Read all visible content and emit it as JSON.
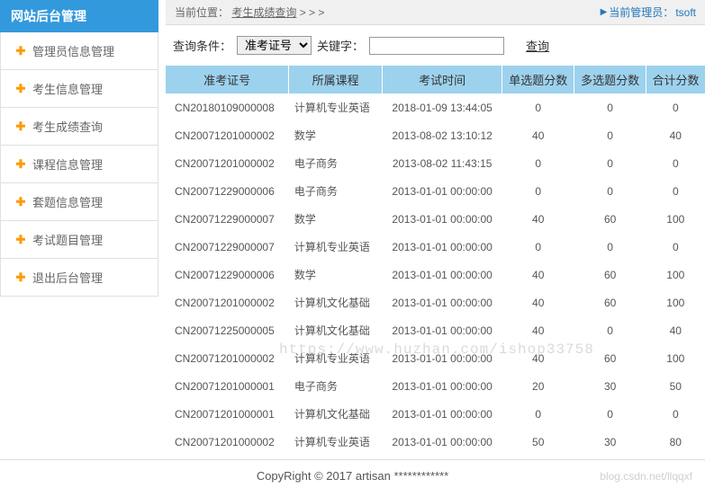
{
  "sidebar": {
    "title": "网站后台管理",
    "items": [
      {
        "label": "管理员信息管理"
      },
      {
        "label": "考生信息管理"
      },
      {
        "label": "考生成绩查询"
      },
      {
        "label": "课程信息管理"
      },
      {
        "label": "套题信息管理"
      },
      {
        "label": "考试题目管理"
      },
      {
        "label": "退出后台管理"
      }
    ]
  },
  "topbar": {
    "crumb_label": "当前位置：",
    "crumb_link": "考生成绩查询",
    "crumb_suffix": " > > >",
    "admin_label": "当前管理员：",
    "admin_name": "tsoft"
  },
  "search": {
    "cond_label": "查询条件：",
    "select_value": "准考证号",
    "keyword_label": "关键字：",
    "input_value": "",
    "btn_label": "查询"
  },
  "table": {
    "headers": [
      "准考证号",
      "所属课程",
      "考试时间",
      "单选题分数",
      "多选题分数",
      "合计分数"
    ],
    "rows": [
      [
        "CN20180109000008",
        "计算机专业英语",
        "2018-01-09 13:44:05",
        "0",
        "0",
        "0"
      ],
      [
        "CN20071201000002",
        "数学",
        "2013-08-02 13:10:12",
        "40",
        "0",
        "40"
      ],
      [
        "CN20071201000002",
        "电子商务",
        "2013-08-02 11:43:15",
        "0",
        "0",
        "0"
      ],
      [
        "CN20071229000006",
        "电子商务",
        "2013-01-01 00:00:00",
        "0",
        "0",
        "0"
      ],
      [
        "CN20071229000007",
        "数学",
        "2013-01-01 00:00:00",
        "40",
        "60",
        "100"
      ],
      [
        "CN20071229000007",
        "计算机专业英语",
        "2013-01-01 00:00:00",
        "0",
        "0",
        "0"
      ],
      [
        "CN20071229000006",
        "数学",
        "2013-01-01 00:00:00",
        "40",
        "60",
        "100"
      ],
      [
        "CN20071201000002",
        "计算机文化基础",
        "2013-01-01 00:00:00",
        "40",
        "60",
        "100"
      ],
      [
        "CN20071225000005",
        "计算机文化基础",
        "2013-01-01 00:00:00",
        "40",
        "0",
        "40"
      ],
      [
        "CN20071201000002",
        "计算机专业英语",
        "2013-01-01 00:00:00",
        "40",
        "60",
        "100"
      ],
      [
        "CN20071201000001",
        "电子商务",
        "2013-01-01 00:00:00",
        "20",
        "30",
        "50"
      ],
      [
        "CN20071201000001",
        "计算机文化基础",
        "2013-01-01 00:00:00",
        "0",
        "0",
        "0"
      ],
      [
        "CN20071201000002",
        "计算机专业英语",
        "2013-01-01 00:00:00",
        "50",
        "30",
        "80"
      ]
    ]
  },
  "footer": {
    "text": "CopyRight © 2017 artisan ************"
  },
  "watermark": {
    "bottom": "blog.csdn.net/llqqxf",
    "mid": "https://www.huzhan.com/ishop33758"
  }
}
